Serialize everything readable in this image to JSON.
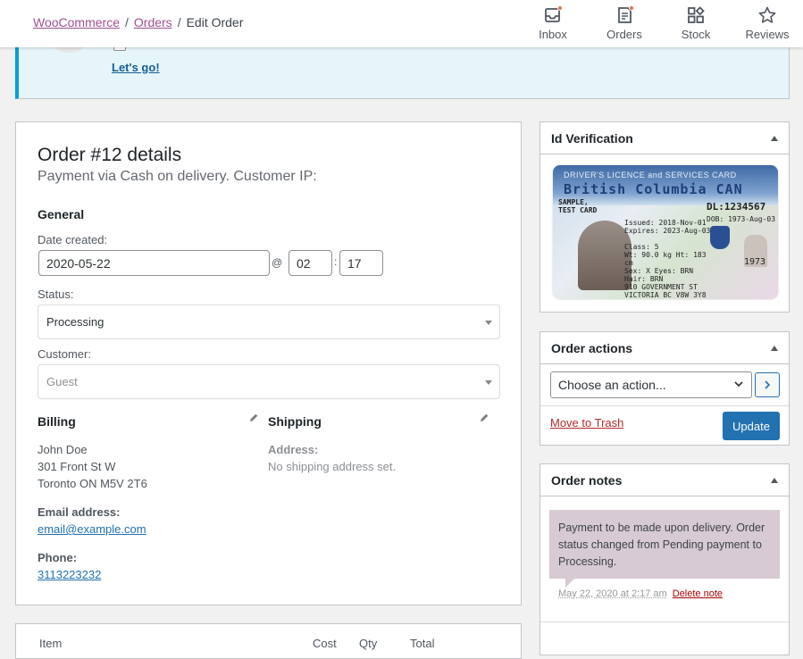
{
  "breadcrumb": {
    "woocommerce": "WooCommerce",
    "orders": "Orders",
    "current": "Edit Order",
    "sep": "/"
  },
  "topnav": [
    {
      "label": "Inbox",
      "icon": "inbox-icon"
    },
    {
      "label": "Orders",
      "icon": "orders-icon"
    },
    {
      "label": "Stock",
      "icon": "stock-icon"
    },
    {
      "label": "Reviews",
      "icon": "star-icon"
    }
  ],
  "notice": {
    "cta": "Let's go!"
  },
  "order": {
    "title": "Order #12 details",
    "subtitle": "Payment via Cash on delivery. Customer IP:",
    "general_heading": "General",
    "date_label": "Date created:",
    "date_value": "2020-05-22",
    "at": "@",
    "hour": "02",
    "colon": ":",
    "minute": "17",
    "status_label": "Status:",
    "status_value": "Processing",
    "customer_label": "Customer:",
    "customer_value": "Guest",
    "billing_heading": "Billing",
    "billing_name": "John Doe",
    "billing_street": "301 Front St W",
    "billing_city": "Toronto ON M5V 2T6",
    "email_label": "Email address:",
    "email": "email@example.com",
    "phone_label": "Phone:",
    "phone": "3113223232",
    "shipping_heading": "Shipping",
    "address_label": "Address:",
    "no_shipping": "No shipping address set."
  },
  "items_header": {
    "item": "Item",
    "cost": "Cost",
    "qty": "Qty",
    "total": "Total"
  },
  "id_verification": {
    "title": "Id Verification",
    "card": {
      "top_line": "DRIVER'S LICENCE and SERVICES CARD",
      "province": "British Columbia  CAN",
      "name_line1": "SAMPLE,",
      "name_line2": "TEST CARD",
      "dl": "DL:1234567",
      "dob": "DOB: 1973-Aug-03",
      "issued": "Issued: 2018-Nov-01",
      "expires": "Expires: 2023-Aug-03",
      "class": "Class: 5",
      "measures": "Wt: 90.0 kg  Ht: 183 cm",
      "sex": "Sex: X  Eyes: BRN  Hair: BRN",
      "address1": "910 GOVERNMENT ST",
      "address2": "VICTORIA BC  V8W 3Y8",
      "year": "1973"
    }
  },
  "order_actions": {
    "title": "Order actions",
    "select_value": "Choose an action...",
    "trash": "Move to Trash",
    "update": "Update"
  },
  "order_notes": {
    "title": "Order notes",
    "note_text": "Payment to be made upon delivery. Order status changed from Pending payment to Processing.",
    "note_date": "May 22, 2020 at 2:17 am",
    "delete": "Delete note"
  },
  "colors": {
    "accent": "#2271b1",
    "woo": "#a0508f",
    "note_bg": "#d7cad2",
    "trash": "#b32d2e"
  }
}
